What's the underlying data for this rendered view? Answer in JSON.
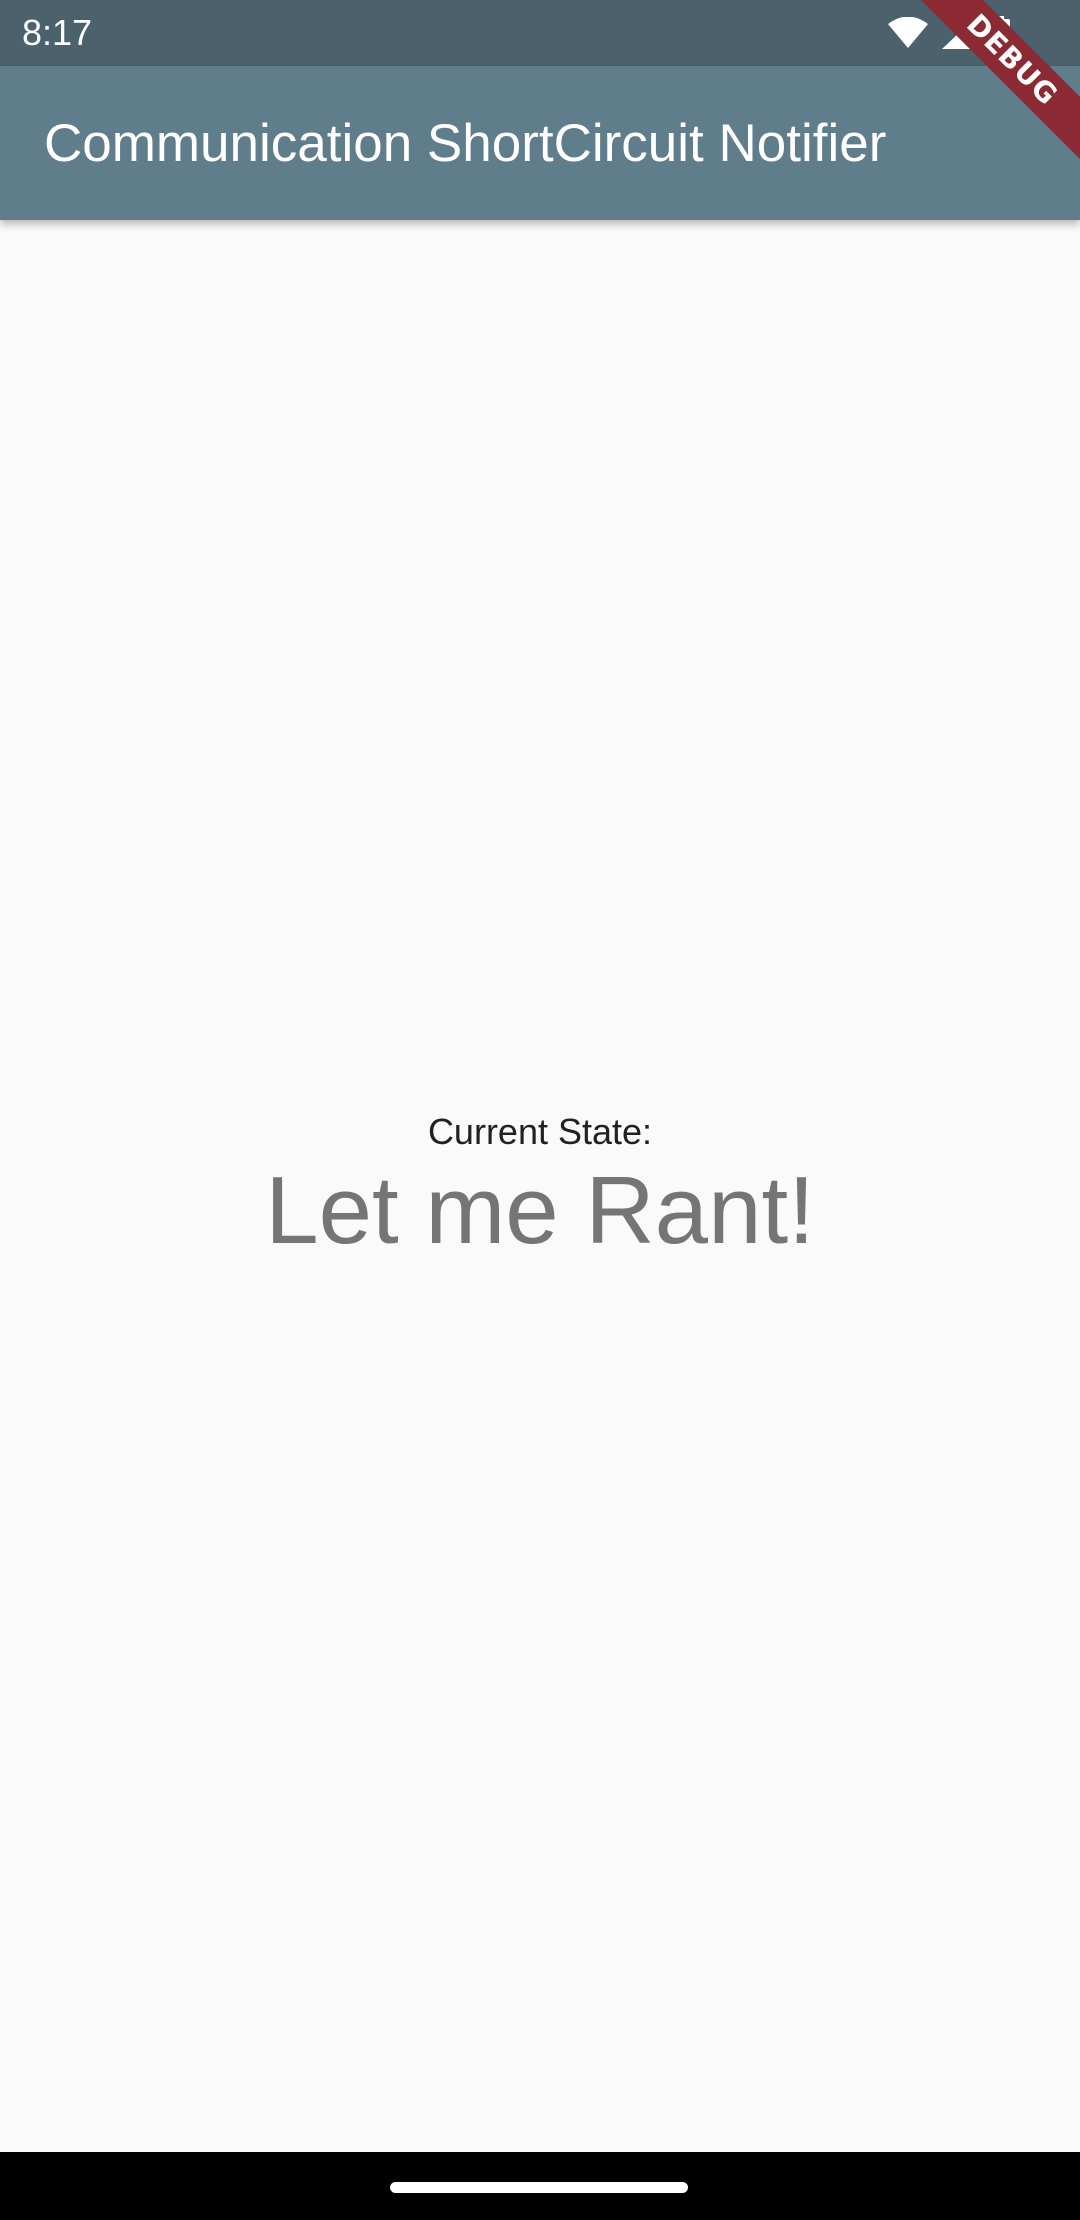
{
  "status_bar": {
    "time": "8:17",
    "icons": [
      "wifi-icon",
      "signal-icon",
      "battery-icon"
    ]
  },
  "app_bar": {
    "title": "Communication ShortCircuit Notifier"
  },
  "debug_banner": {
    "label": "DEBUG"
  },
  "main": {
    "state_label": "Current State:",
    "state_value": "Let me Rant!"
  },
  "colors": {
    "status_bar": "#4b626d",
    "app_bar": "#607d8b",
    "background": "#fafafa",
    "debug_ribbon": "#8b2a33",
    "state_value_text": "#757575"
  }
}
